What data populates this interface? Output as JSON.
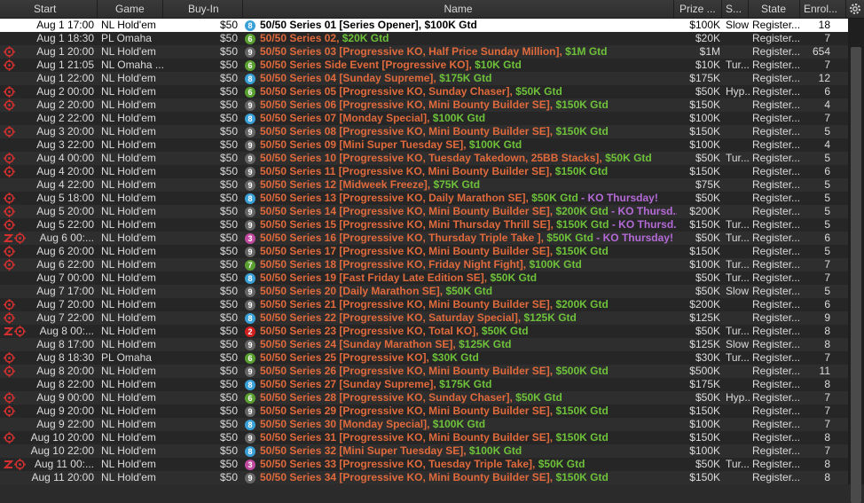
{
  "headers": {
    "start": "Start",
    "game": "Game",
    "buyin": "Buy-In",
    "name": "Name",
    "prize": "Prize ...",
    "speed": "S...",
    "state": "State",
    "enrol": "Enrol..."
  },
  "colors": {
    "orange": "#e06a3c",
    "green": "#6ec23a",
    "purple": "#b46ad6",
    "target": "#d03030"
  },
  "rows": [
    {
      "icons": "",
      "start": "Aug 1  17:00",
      "game": "NL Hold'em",
      "buyin": "$50",
      "num": "8",
      "numc": "#3aa0d8",
      "name": "50/50 Series 01 [Series Opener], $100K Gtd",
      "gtd": "",
      "ko": "",
      "prize": "$100K",
      "speed": "Slow",
      "state": "Register...",
      "enrol": "18",
      "sel": true
    },
    {
      "icons": "",
      "start": "Aug 1  18:30",
      "game": "PL Omaha",
      "buyin": "$50",
      "num": "6",
      "numc": "#5aa030",
      "name": "50/50 Series 02, ",
      "gtd": "$20K Gtd",
      "ko": "",
      "prize": "$20K",
      "speed": "",
      "state": "Register...",
      "enrol": "7"
    },
    {
      "icons": "t",
      "start": "Aug 1  20:00",
      "game": "NL Hold'em",
      "buyin": "$50",
      "num": "9",
      "numc": "#666",
      "name": "50/50 Series 03 [Progressive KO, Half Price Sunday Million], ",
      "gtd": "$1M Gtd",
      "ko": "",
      "prize": "$1M",
      "speed": "",
      "state": "Register...",
      "enrol": "654"
    },
    {
      "icons": "t",
      "start": "Aug 1  21:05",
      "game": "NL Omaha ...",
      "buyin": "$50",
      "num": "6",
      "numc": "#5aa030",
      "name": "50/50 Series Side Event [Progressive KO], ",
      "gtd": "$10K Gtd",
      "ko": "",
      "prize": "$10K",
      "speed": "Tur...",
      "state": "Register...",
      "enrol": "7"
    },
    {
      "icons": "",
      "start": "Aug 1  22:00",
      "game": "NL Hold'em",
      "buyin": "$50",
      "num": "8",
      "numc": "#3aa0d8",
      "name": "50/50 Series 04 [Sunday Supreme], ",
      "gtd": "$175K Gtd",
      "ko": "",
      "prize": "$175K",
      "speed": "",
      "state": "Register...",
      "enrol": "12"
    },
    {
      "icons": "t",
      "start": "Aug 2  00:00",
      "game": "NL Hold'em",
      "buyin": "$50",
      "num": "6",
      "numc": "#5aa030",
      "name": "50/50 Series 05 [Progressive KO, Sunday Chaser], ",
      "gtd": "$50K Gtd",
      "ko": "",
      "prize": "$50K",
      "speed": "Hyp...",
      "state": "Register...",
      "enrol": "6"
    },
    {
      "icons": "t",
      "start": "Aug 2  20:00",
      "game": "NL Hold'em",
      "buyin": "$50",
      "num": "9",
      "numc": "#666",
      "name": "50/50 Series 06 [Progressive KO, Mini Bounty Builder SE], ",
      "gtd": "$150K Gtd",
      "ko": "",
      "prize": "$150K",
      "speed": "",
      "state": "Register...",
      "enrol": "4"
    },
    {
      "icons": "",
      "start": "Aug 2  22:00",
      "game": "NL Hold'em",
      "buyin": "$50",
      "num": "8",
      "numc": "#3aa0d8",
      "name": "50/50 Series 07 [Monday Special], ",
      "gtd": "$100K Gtd",
      "ko": "",
      "prize": "$100K",
      "speed": "",
      "state": "Register...",
      "enrol": "7"
    },
    {
      "icons": "t",
      "start": "Aug 3  20:00",
      "game": "NL Hold'em",
      "buyin": "$50",
      "num": "9",
      "numc": "#666",
      "name": "50/50 Series 08 [Progressive KO, Mini Bounty Builder SE], ",
      "gtd": "$150K Gtd",
      "ko": "",
      "prize": "$150K",
      "speed": "",
      "state": "Register...",
      "enrol": "5"
    },
    {
      "icons": "",
      "start": "Aug 3  22:00",
      "game": "NL Hold'em",
      "buyin": "$50",
      "num": "9",
      "numc": "#666",
      "name": "50/50 Series 09 [Mini Super Tuesday SE], ",
      "gtd": "$100K Gtd",
      "ko": "",
      "prize": "$100K",
      "speed": "",
      "state": "Register...",
      "enrol": "4"
    },
    {
      "icons": "t",
      "start": "Aug 4  00:00",
      "game": "NL Hold'em",
      "buyin": "$50",
      "num": "9",
      "numc": "#666",
      "name": "50/50 Series 10 [Progressive KO, Tuesday Takedown, 25BB Stacks], ",
      "gtd": "$50K Gtd",
      "ko": "",
      "prize": "$50K",
      "speed": "Tur...",
      "state": "Register...",
      "enrol": "5"
    },
    {
      "icons": "t",
      "start": "Aug 4  20:00",
      "game": "NL Hold'em",
      "buyin": "$50",
      "num": "9",
      "numc": "#666",
      "name": "50/50 Series 11 [Progressive KO, Mini Bounty Builder SE], ",
      "gtd": "$150K Gtd",
      "ko": "",
      "prize": "$150K",
      "speed": "",
      "state": "Register...",
      "enrol": "6"
    },
    {
      "icons": "",
      "start": "Aug 4  22:00",
      "game": "NL Hold'em",
      "buyin": "$50",
      "num": "9",
      "numc": "#666",
      "name": "50/50 Series 12 [Midweek Freeze], ",
      "gtd": "$75K Gtd",
      "ko": "",
      "prize": "$75K",
      "speed": "",
      "state": "Register...",
      "enrol": "5"
    },
    {
      "icons": "t",
      "start": "Aug 5  18:00",
      "game": "NL Hold'em",
      "buyin": "$50",
      "num": "8",
      "numc": "#3aa0d8",
      "name": "50/50 Series 13 [Progressive KO, Daily Marathon SE], ",
      "gtd": "$50K Gtd",
      "ko": " - KO Thursday!",
      "prize": "$50K",
      "speed": "",
      "state": "Register...",
      "enrol": "5"
    },
    {
      "icons": "t",
      "start": "Aug 5  20:00",
      "game": "NL Hold'em",
      "buyin": "$50",
      "num": "9",
      "numc": "#666",
      "name": "50/50 Series 14 [Progressive KO, Mini Bounty Builder SE], ",
      "gtd": "$200K Gtd",
      "ko": " - KO Thursd...",
      "prize": "$200K",
      "speed": "",
      "state": "Register...",
      "enrol": "5"
    },
    {
      "icons": "t",
      "start": "Aug 5  22:00",
      "game": "NL Hold'em",
      "buyin": "$50",
      "num": "9",
      "numc": "#666",
      "name": "50/50 Series 15 [Progressive KO, Mini Thursday Thrill SE], ",
      "gtd": "$150K Gtd",
      "ko": " - KO Thursd...",
      "prize": "$150K",
      "speed": "Tur...",
      "state": "Register...",
      "enrol": "5"
    },
    {
      "icons": "zt",
      "start": "Aug 6  00:...",
      "game": "NL Hold'em",
      "buyin": "$50",
      "num": "3",
      "numc": "#c04aa0",
      "name": "50/50 Series 16 [Progressive KO, Thursday Triple Take ], ",
      "gtd": "$50K Gtd",
      "ko": " - KO Thursday!",
      "prize": "$50K",
      "speed": "Tur...",
      "state": "Register...",
      "enrol": "6"
    },
    {
      "icons": "t",
      "start": "Aug 6  20:00",
      "game": "NL Hold'em",
      "buyin": "$50",
      "num": "9",
      "numc": "#666",
      "name": "50/50 Series 17 [Progressive KO, Mini Bounty Builder SE], ",
      "gtd": "$150K Gtd",
      "ko": "",
      "prize": "$150K",
      "speed": "",
      "state": "Register...",
      "enrol": "5"
    },
    {
      "icons": "t",
      "start": "Aug 6  22:00",
      "game": "NL Hold'em",
      "buyin": "$50",
      "num": "7",
      "numc": "#5aa030",
      "name": "50/50 Series 18 [Progressive KO, Friday Night Fight], ",
      "gtd": "$100K Gtd",
      "ko": "",
      "prize": "$100K",
      "speed": "Tur...",
      "state": "Register...",
      "enrol": "7"
    },
    {
      "icons": "",
      "start": "Aug 7  00:00",
      "game": "NL Hold'em",
      "buyin": "$50",
      "num": "8",
      "numc": "#3aa0d8",
      "name": "50/50 Series 19 [Fast Friday Late Edition SE], ",
      "gtd": "$50K Gtd",
      "ko": "",
      "prize": "$50K",
      "speed": "Tur...",
      "state": "Register...",
      "enrol": "7"
    },
    {
      "icons": "",
      "start": "Aug 7  17:00",
      "game": "NL Hold'em",
      "buyin": "$50",
      "num": "9",
      "numc": "#666",
      "name": "50/50 Series 20 [Daily Marathon SE], ",
      "gtd": "$50K Gtd",
      "ko": "",
      "prize": "$50K",
      "speed": "Slow",
      "state": "Register...",
      "enrol": "5"
    },
    {
      "icons": "t",
      "start": "Aug 7  20:00",
      "game": "NL Hold'em",
      "buyin": "$50",
      "num": "9",
      "numc": "#666",
      "name": "50/50 Series 21 [Progressive KO, Mini Bounty Builder SE], ",
      "gtd": "$200K Gtd",
      "ko": "",
      "prize": "$200K",
      "speed": "",
      "state": "Register...",
      "enrol": "6"
    },
    {
      "icons": "t",
      "start": "Aug 7  22:00",
      "game": "NL Hold'em",
      "buyin": "$50",
      "num": "8",
      "numc": "#3aa0d8",
      "name": "50/50 Series 22 [Progressive KO, Saturday Special], ",
      "gtd": "$125K Gtd",
      "ko": "",
      "prize": "$125K",
      "speed": "",
      "state": "Register...",
      "enrol": "9"
    },
    {
      "icons": "zt",
      "start": "Aug 8  00:...",
      "game": "NL Hold'em",
      "buyin": "$50",
      "num": "2",
      "numc": "#d02020",
      "name": "50/50 Series 23 [Progressive KO, Total KO], ",
      "gtd": "$50K Gtd",
      "ko": "",
      "prize": "$50K",
      "speed": "Tur...",
      "state": "Register...",
      "enrol": "8"
    },
    {
      "icons": "",
      "start": "Aug 8  17:00",
      "game": "NL Hold'em",
      "buyin": "$50",
      "num": "9",
      "numc": "#666",
      "name": "50/50 Series 24 [Sunday Marathon SE], ",
      "gtd": "$125K Gtd",
      "ko": "",
      "prize": "$125K",
      "speed": "Slow",
      "state": "Register...",
      "enrol": "8"
    },
    {
      "icons": "t",
      "start": "Aug 8  18:30",
      "game": "PL Omaha",
      "buyin": "$50",
      "num": "6",
      "numc": "#5aa030",
      "name": "50/50 Series 25 [Progressive KO], ",
      "gtd": "$30K Gtd",
      "ko": "",
      "prize": "$30K",
      "speed": "Tur...",
      "state": "Register...",
      "enrol": "7"
    },
    {
      "icons": "t",
      "start": "Aug 8  20:00",
      "game": "NL Hold'em",
      "buyin": "$50",
      "num": "9",
      "numc": "#666",
      "name": "50/50 Series 26 [Progressive KO, Mini Bounty Builder SE], ",
      "gtd": "$500K Gtd",
      "ko": "",
      "prize": "$500K",
      "speed": "",
      "state": "Register...",
      "enrol": "11"
    },
    {
      "icons": "",
      "start": "Aug 8  22:00",
      "game": "NL Hold'em",
      "buyin": "$50",
      "num": "8",
      "numc": "#3aa0d8",
      "name": "50/50 Series 27 [Sunday Supreme], ",
      "gtd": "$175K Gtd",
      "ko": "",
      "prize": "$175K",
      "speed": "",
      "state": "Register...",
      "enrol": "8"
    },
    {
      "icons": "t",
      "start": "Aug 9  00:00",
      "game": "NL Hold'em",
      "buyin": "$50",
      "num": "6",
      "numc": "#5aa030",
      "name": "50/50 Series 28 [Progressive KO, Sunday Chaser], ",
      "gtd": "$50K Gtd",
      "ko": "",
      "prize": "$50K",
      "speed": "Hyp...",
      "state": "Register...",
      "enrol": "7"
    },
    {
      "icons": "t",
      "start": "Aug 9  20:00",
      "game": "NL Hold'em",
      "buyin": "$50",
      "num": "9",
      "numc": "#666",
      "name": "50/50 Series 29 [Progressive KO, Mini Bounty Builder SE], ",
      "gtd": "$150K Gtd",
      "ko": "",
      "prize": "$150K",
      "speed": "",
      "state": "Register...",
      "enrol": "7"
    },
    {
      "icons": "",
      "start": "Aug 9  22:00",
      "game": "NL Hold'em",
      "buyin": "$50",
      "num": "8",
      "numc": "#3aa0d8",
      "name": "50/50 Series 30 [Monday Special], ",
      "gtd": "$100K Gtd",
      "ko": "",
      "prize": "$100K",
      "speed": "",
      "state": "Register...",
      "enrol": "7"
    },
    {
      "icons": "t",
      "start": "Aug 10  20:00",
      "game": "NL Hold'em",
      "buyin": "$50",
      "num": "9",
      "numc": "#666",
      "name": "50/50 Series 31 [Progressive KO, Mini Bounty Builder SE], ",
      "gtd": "$150K Gtd",
      "ko": "",
      "prize": "$150K",
      "speed": "",
      "state": "Register...",
      "enrol": "8"
    },
    {
      "icons": "",
      "start": "Aug 10  22:00",
      "game": "NL Hold'em",
      "buyin": "$50",
      "num": "8",
      "numc": "#3aa0d8",
      "name": "50/50 Series 32 [Mini Super Tuesday SE], ",
      "gtd": "$100K Gtd",
      "ko": "",
      "prize": "$100K",
      "speed": "",
      "state": "Register...",
      "enrol": "7"
    },
    {
      "icons": "zt",
      "start": "Aug 11  00:...",
      "game": "NL Hold'em",
      "buyin": "$50",
      "num": "3",
      "numc": "#c04aa0",
      "name": "50/50 Series 33 [Progressive KO, Tuesday Triple Take], ",
      "gtd": "$50K Gtd",
      "ko": "",
      "prize": "$50K",
      "speed": "Tur...",
      "state": "Register...",
      "enrol": "8"
    },
    {
      "icons": "",
      "start": "Aug 11  20:00",
      "game": "NL Hold'em",
      "buyin": "$50",
      "num": "9",
      "numc": "#666",
      "name": "50/50 Series 34 [Progressive KO, Mini Bounty Builder SE], ",
      "gtd": "$150K Gtd",
      "ko": "",
      "prize": "$150K",
      "speed": "",
      "state": "Register...",
      "enrol": "8"
    }
  ]
}
